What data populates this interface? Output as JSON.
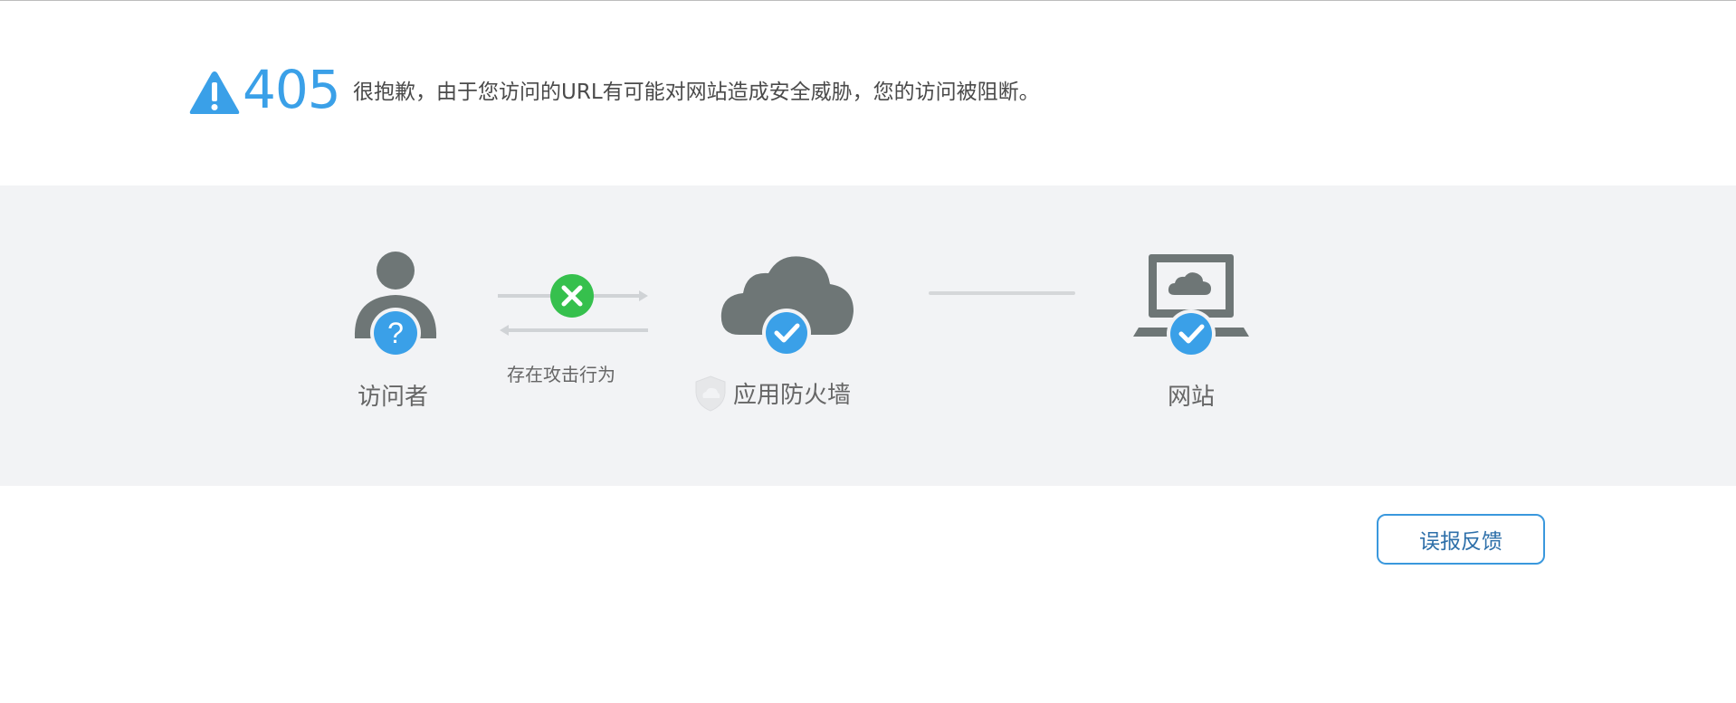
{
  "error": {
    "code": "405",
    "message": "很抱歉，由于您访问的URL有可能对网站造成安全威胁，您的访问被阻断。"
  },
  "diagram": {
    "visitor_label": "访问者",
    "attack_label": "存在攻击行为",
    "firewall_label": "应用防火墙",
    "site_label": "网站"
  },
  "feedback_button": {
    "label": "误报反馈"
  },
  "icons": {
    "warning": "warning-triangle-icon",
    "visitor": "person-question-icon",
    "blocked": "red-x-circle-icon",
    "firewall": "cloud-check-icon",
    "site": "laptop-cloud-check-icon",
    "shield": "shield-icon"
  },
  "colors": {
    "accent_blue": "#3aa0e8",
    "block_green": "#36c04d",
    "icon_gray": "#6e7676",
    "band_bg": "#f2f3f5"
  }
}
